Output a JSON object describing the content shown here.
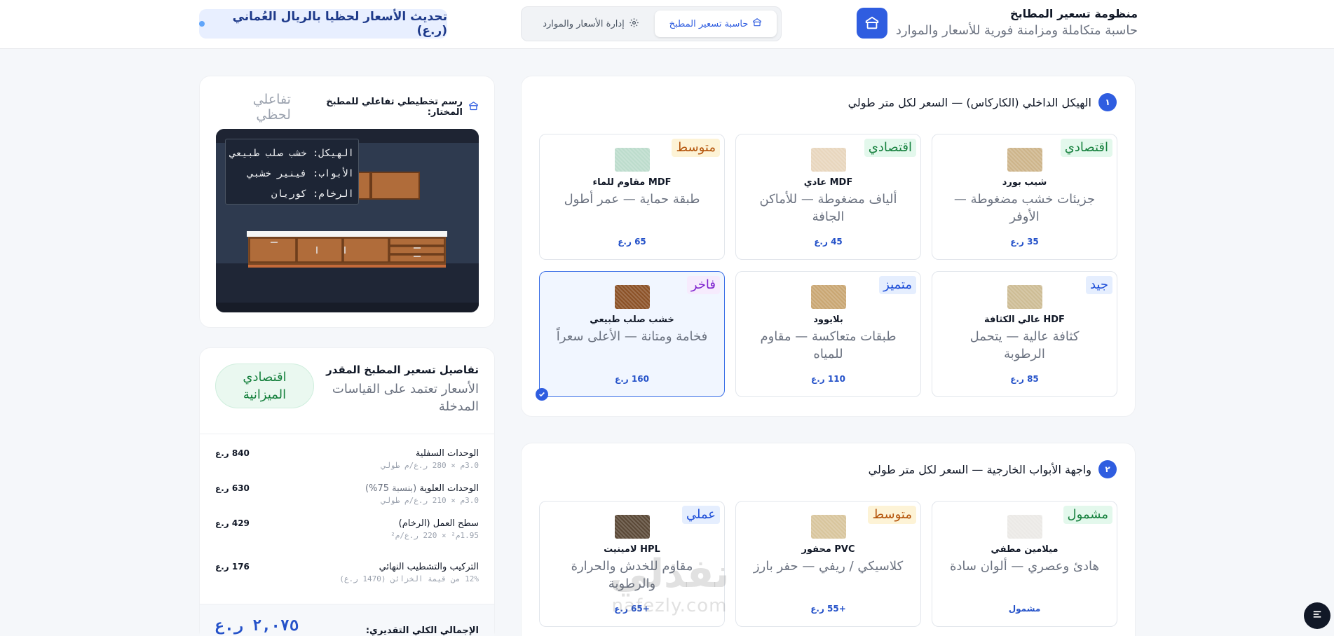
{
  "header": {
    "brand_title": "منظومة تسعير المطابخ",
    "brand_subtitle": "حاسبة متكاملة ومزامنة فورية للأسعار والموارد",
    "brand_icon": "kitchen-icon",
    "tabs": [
      {
        "label": "حاسبة تسعير المطبخ",
        "icon": "kitchen-icon",
        "active": true
      },
      {
        "label": "إدارة الأسعار والموارد",
        "icon": "gear-icon",
        "active": false
      }
    ],
    "status_text": "تحديث الأسعار لحظيا بالريال العُماني (ر.ع)",
    "status_color": "#60a5fa"
  },
  "section1": {
    "number": "١",
    "title": "الهيكل الداخلي (الكاركاس) — السعر لكل متر طولي",
    "cards": [
      {
        "badge": "اقتصادي",
        "title": "شيب بورد",
        "desc": "جزيئات خشب مضغوطة — الأوفر",
        "price": "35 ر.ع",
        "swatch": "#cdb48a",
        "selected": false
      },
      {
        "badge": "اقتصادي",
        "title": "MDF عادي",
        "desc": "ألياف مضغوطة — للأماكن الجافة",
        "price": "45 ر.ع",
        "swatch": "#e8d6bd",
        "selected": false
      },
      {
        "badge": "متوسط",
        "title": "MDF مقاوم للماء",
        "desc": "طبقة حماية — عمر أطول",
        "price": "65 ر.ع",
        "swatch": "#bcdccc",
        "selected": false
      },
      {
        "badge": "جيد",
        "title": "HDF عالي الكثافة",
        "desc": "كثافة عالية — يتحمل الرطوبة",
        "price": "85 ر.ع",
        "swatch": "#cdbc94",
        "selected": false
      },
      {
        "badge": "متميز",
        "title": "بلايوود",
        "desc": "طبقات متعاكسة — مقاوم للمياه",
        "price": "110 ر.ع",
        "swatch": "#c9a672",
        "selected": false
      },
      {
        "badge": "فاخر",
        "title": "خشب صلب طبيعي",
        "desc": "فخامة ومتانة — الأعلى سعراً",
        "price": "160 ر.ع",
        "swatch": "#8b5126",
        "selected": true
      }
    ]
  },
  "section2": {
    "number": "٢",
    "title": "واجهة الأبواب الخارجية — السعر لكل متر طولي",
    "cards": [
      {
        "badge": "مشمول",
        "title": "ميلامين مطفي",
        "desc": "هادئ وعصري — ألوان سادة",
        "price": "مشمول",
        "swatch": "#ebe9e6"
      },
      {
        "badge": "متوسط",
        "title": "PVC محفور",
        "desc": "كلاسيكي / ريفي — حفر بارز",
        "price": "+55 ر.ع",
        "swatch": "#d8c59c"
      },
      {
        "badge": "عملي",
        "title": "HPL لامينيت",
        "desc": "مقاوم للخدش والحرارة والرطوبة",
        "price": "+65 ر.ع",
        "swatch": "#5a4836"
      }
    ]
  },
  "sketch": {
    "title": "رسم تخطيطي تفاعلي للمطبخ المختار:",
    "live_label": "تفاعلي لحظي",
    "legend": [
      {
        "key": "الهيكل:",
        "value": "خشب صلب طبيعي"
      },
      {
        "key": "الأبواب:",
        "value": "فينير خشبي"
      },
      {
        "key": "الرخام:",
        "value": "كوريان"
      }
    ]
  },
  "pricing": {
    "title": "تفاصيل تسعير المطبخ المقدر",
    "subtitle": "الأسعار تعتمد على القياسات المدخلة",
    "badge": "اقتصادي الميزانية",
    "rows": [
      {
        "name": "الوحدات السفلية",
        "note": "",
        "calc": "3.0م × 280 ر.ع/م طولي",
        "amount": "840 ر.ع"
      },
      {
        "name": "الوحدات العلوية",
        "note": "(بنسبة 75%)",
        "calc": "3.0م × 210 ر.ع/م طولي",
        "amount": "630 ر.ع"
      },
      {
        "name": "سطح العمل (الرخام)",
        "note": "",
        "calc": "1.95م² × 220 ر.ع/م²",
        "amount": "429 ر.ع"
      },
      {
        "name": "التركيب والتشطيب النهائي",
        "note": "",
        "calc": "12% من قيمة الخزائن (1470 ر.ع)",
        "amount": "176 ر.ع"
      }
    ],
    "total_label": "الإجمالي الكلي التقديري:",
    "total_amount": "٢,٠٧٥ ر.ع"
  },
  "watermark": {
    "arabic": "نفذلي",
    "latin": "nafezly.com"
  },
  "colors": {
    "accent": "#2f5de0",
    "price": "#2552c9"
  }
}
